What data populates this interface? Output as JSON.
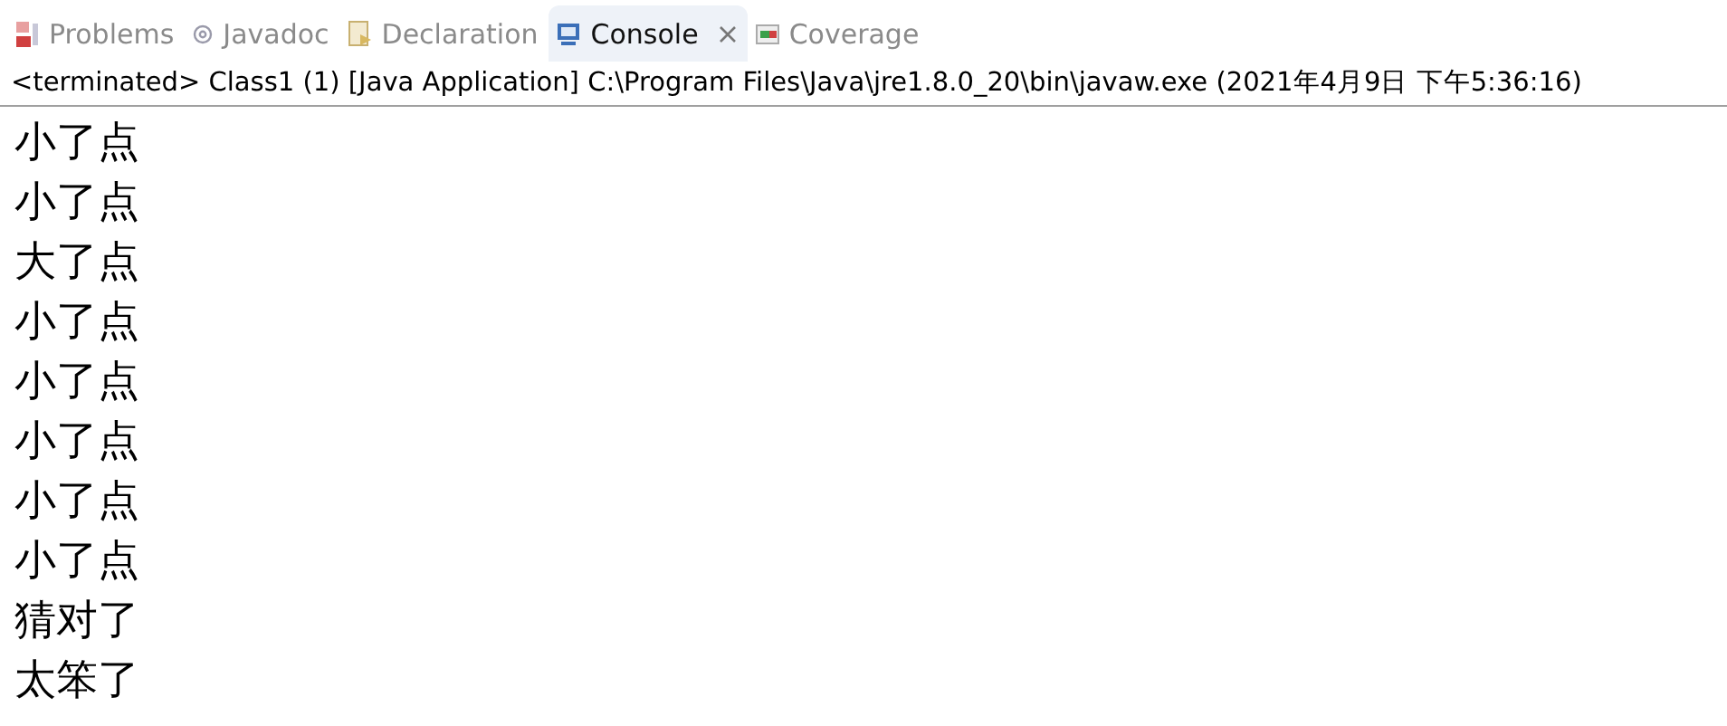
{
  "tabs": [
    {
      "label": "Problems",
      "selected": false
    },
    {
      "label": "Javadoc",
      "selected": false
    },
    {
      "label": "Declaration",
      "selected": false
    },
    {
      "label": "Console",
      "selected": true
    },
    {
      "label": "Coverage",
      "selected": false
    }
  ],
  "console": {
    "header": "<terminated> Class1 (1) [Java Application] C:\\Program Files\\Java\\jre1.8.0_20\\bin\\javaw.exe (2021年4月9日 下午5:36:16)",
    "lines": [
      "小了点",
      "小了点",
      "大了点",
      "小了点",
      "小了点",
      "小了点",
      "小了点",
      "小了点",
      "猜对了",
      "太笨了"
    ]
  }
}
